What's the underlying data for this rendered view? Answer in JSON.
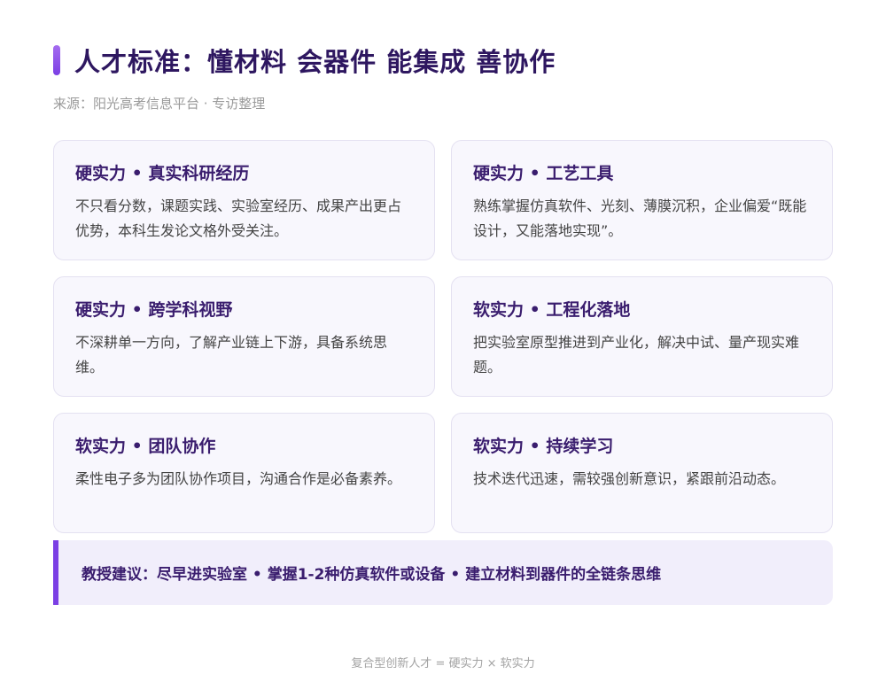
{
  "title": "人才标准：懂材料 会器件 能集成 善协作",
  "source": "来源：阳光高考信息平台 · 专访整理",
  "cards": [
    {
      "title": "硬实力 • 真实科研经历",
      "body": "不只看分数，课题实践、实验室经历、成果产出更占优势，本科生发论文格外受关注。"
    },
    {
      "title": "硬实力 • 工艺工具",
      "body": "熟练掌握仿真软件、光刻、薄膜沉积，企业偏爱“既能设计，又能落地实现”。"
    },
    {
      "title": "硬实力 • 跨学科视野",
      "body": "不深耕单一方向，了解产业链上下游，具备系统思维。"
    },
    {
      "title": "软实力 • 工程化落地",
      "body": "把实验室原型推进到产业化，解决中试、量产现实难题。"
    },
    {
      "title": "软实力 • 团队协作",
      "body": "柔性电子多为团队协作项目，沟通合作是必备素养。"
    },
    {
      "title": "软实力 • 持续学习",
      "body": "技术迭代迅速，需较强创新意识，紧跟前沿动态。"
    }
  ],
  "advice": "教授建议：尽早进实验室 • 掌握1-2种仿真软件或设备 • 建立材料到器件的全链条思维",
  "footer": "复合型创新人才 = 硬实力 × 软实力",
  "colors": {
    "accent": "#7b3fe4",
    "title_text": "#2e1760",
    "card_bg": "#f8f7fd",
    "advice_bg": "#f1eefb"
  }
}
